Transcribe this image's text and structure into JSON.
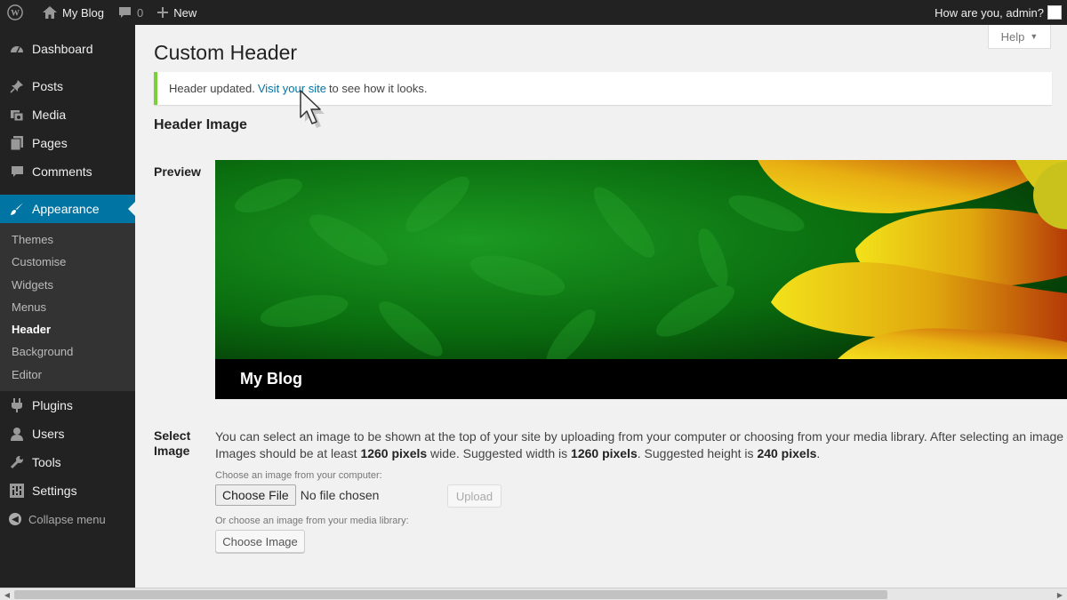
{
  "adminbar": {
    "site_name": "My Blog",
    "comment_count": "0",
    "new_label": "New",
    "greeting": "How are you, admin?"
  },
  "sidebar": {
    "items_top": [
      {
        "label": "Dashboard",
        "icon": "dashboard-icon"
      }
    ],
    "items_mid": [
      {
        "label": "Posts",
        "icon": "pin-icon"
      },
      {
        "label": "Media",
        "icon": "media-icon"
      },
      {
        "label": "Pages",
        "icon": "pages-icon"
      },
      {
        "label": "Comments",
        "icon": "comments-icon"
      }
    ],
    "current": {
      "label": "Appearance",
      "icon": "brush-icon"
    },
    "submenu": [
      "Themes",
      "Customise",
      "Widgets",
      "Menus",
      "Header",
      "Background",
      "Editor"
    ],
    "submenu_active": "Header",
    "items_bottom": [
      {
        "label": "Plugins",
        "icon": "plugin-icon"
      },
      {
        "label": "Users",
        "icon": "users-icon"
      },
      {
        "label": "Tools",
        "icon": "tools-icon"
      },
      {
        "label": "Settings",
        "icon": "settings-icon"
      }
    ],
    "collapse_label": "Collapse menu"
  },
  "main": {
    "title": "Custom Header",
    "help_label": "Help",
    "notice": {
      "before": "Header updated.",
      "link": "Visit your site",
      "after": "to see how it looks."
    },
    "section_title": "Header Image",
    "preview_label": "Preview",
    "preview_site_title": "My Blog",
    "select_label_1": "Select",
    "select_label_2": "Image",
    "description": {
      "line1": "You can select an image to be shown at the top of your site by uploading from your computer or choosing from your media library. After selecting an image y",
      "line2_a": "Images should be at least ",
      "line2_b": "1260 pixels",
      "line2_c": " wide. Suggested width is ",
      "line2_d": "1260 pixels",
      "line2_e": ". Suggested height is ",
      "line2_f": "240 pixels",
      "line2_g": "."
    },
    "computer_label": "Choose an image from your computer:",
    "choose_file_label": "Choose File",
    "no_file_label": "No file chosen",
    "upload_label": "Upload",
    "library_label": "Or choose an image from your media library:",
    "choose_image_label": "Choose Image"
  },
  "colors": {
    "admin_bar": "#222222",
    "accent": "#0074a2",
    "notice_border": "#7ad03a",
    "header_green": "#0a7a10"
  }
}
